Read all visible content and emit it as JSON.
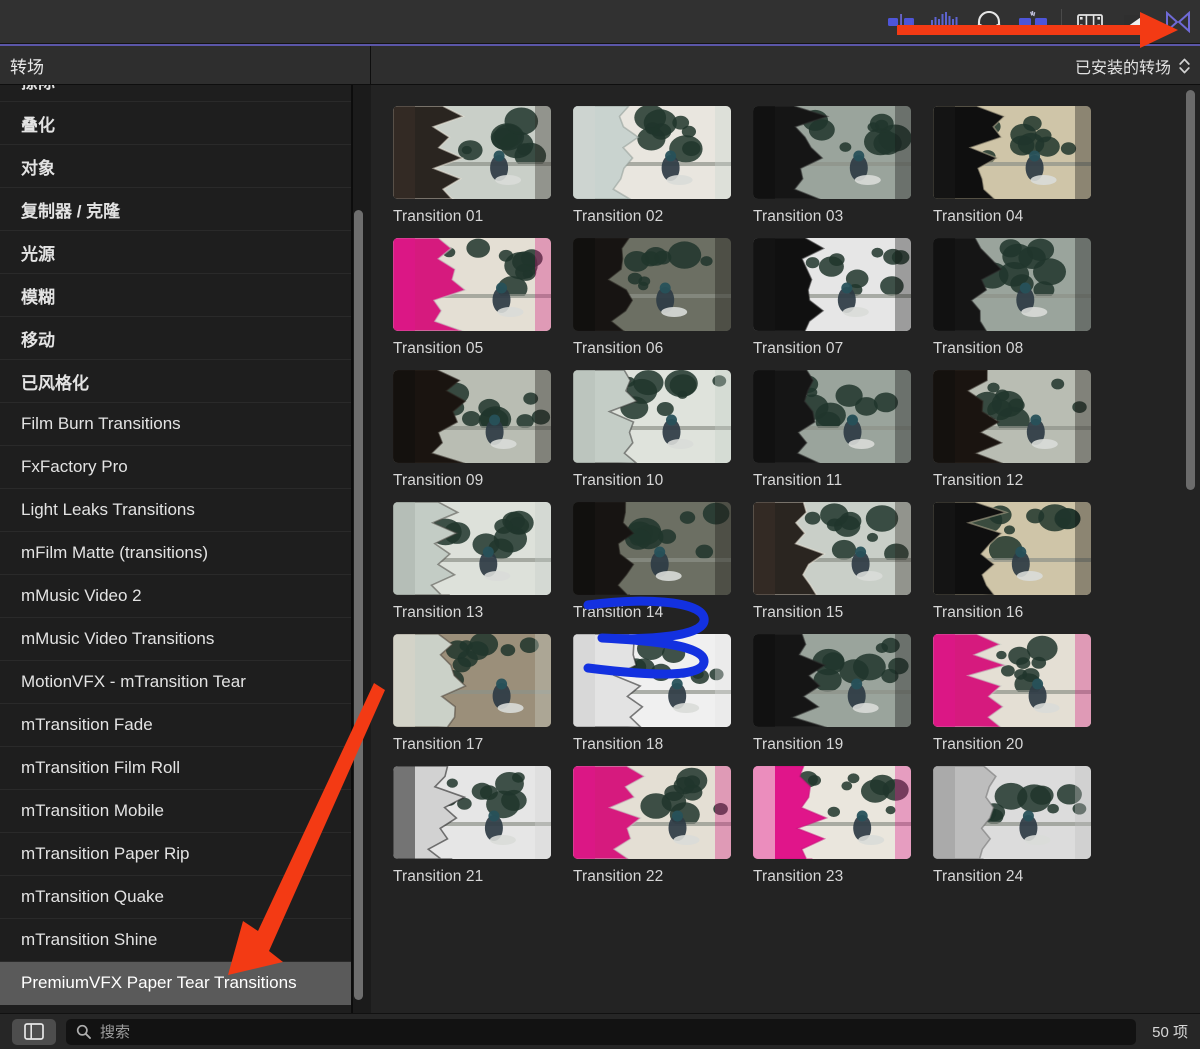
{
  "toolbar": {
    "buttons": [
      {
        "name": "audio-enhance-icon",
        "label": "音频增强"
      },
      {
        "name": "audio-meters-icon",
        "label": "音频指示器"
      },
      {
        "name": "headphones-icon",
        "label": "耳机"
      },
      {
        "name": "color-board-icon",
        "label": "效果"
      },
      {
        "name": "film-strip-icon",
        "label": "媒体"
      },
      {
        "name": "titles-generators-icon",
        "label": "字幕和发生器"
      },
      {
        "name": "transitions-bowtie-icon",
        "label": "转场"
      }
    ],
    "accent_color": "#5b56a8",
    "active_icon_color": "#4e55d8",
    "highlight_color": "#6f6ad6"
  },
  "panel": {
    "title": "转场",
    "popup_label": "已安装的转场"
  },
  "sidebar": {
    "items": [
      {
        "label": "擦际",
        "cjk": true,
        "selected": false
      },
      {
        "label": "叠化",
        "cjk": true,
        "selected": false
      },
      {
        "label": "对象",
        "cjk": true,
        "selected": false
      },
      {
        "label": "复制器 / 克隆",
        "cjk": true,
        "selected": false
      },
      {
        "label": "光源",
        "cjk": true,
        "selected": false
      },
      {
        "label": "模糊",
        "cjk": true,
        "selected": false
      },
      {
        "label": "移动",
        "cjk": true,
        "selected": false
      },
      {
        "label": "已风格化",
        "cjk": true,
        "selected": false
      },
      {
        "label": "Film Burn Transitions",
        "cjk": false,
        "selected": false
      },
      {
        "label": "FxFactory Pro",
        "cjk": false,
        "selected": false
      },
      {
        "label": "Light Leaks Transitions",
        "cjk": false,
        "selected": false
      },
      {
        "label": "mFilm Matte (transitions)",
        "cjk": false,
        "selected": false
      },
      {
        "label": "mMusic Video 2",
        "cjk": false,
        "selected": false
      },
      {
        "label": "mMusic Video Transitions",
        "cjk": false,
        "selected": false
      },
      {
        "label": "MotionVFX - mTransition Tear",
        "cjk": false,
        "selected": false
      },
      {
        "label": "mTransition Fade",
        "cjk": false,
        "selected": false
      },
      {
        "label": "mTransition Film Roll",
        "cjk": false,
        "selected": false
      },
      {
        "label": "mTransition Mobile",
        "cjk": false,
        "selected": false
      },
      {
        "label": "mTransition Paper Rip",
        "cjk": false,
        "selected": false
      },
      {
        "label": "mTransition Quake",
        "cjk": false,
        "selected": false
      },
      {
        "label": "mTransition Shine",
        "cjk": false,
        "selected": false
      },
      {
        "label": "PremiumVFX Paper Tear Transitions",
        "cjk": false,
        "selected": true
      }
    ],
    "selected_background": "#5a5a5a"
  },
  "grid": {
    "items": [
      {
        "label": "Transition 01",
        "style": "tear-right",
        "annotated": false
      },
      {
        "label": "Transition 02",
        "style": "split-portrait",
        "annotated": false
      },
      {
        "label": "Transition 03",
        "style": "dark-rip",
        "annotated": false
      },
      {
        "label": "Transition 04",
        "style": "texture-tear",
        "annotated": false
      },
      {
        "label": "Transition 05",
        "style": "magenta-tear",
        "annotated": false
      },
      {
        "label": "Transition 06",
        "style": "dark-fold",
        "annotated": false
      },
      {
        "label": "Transition 07",
        "style": "karaoke-mono",
        "annotated": false
      },
      {
        "label": "Transition 08",
        "style": "dark-rip",
        "annotated": false
      },
      {
        "label": "Transition 09",
        "style": "night-tear",
        "annotated": false
      },
      {
        "label": "Transition 10",
        "style": "center-fold",
        "annotated": false
      },
      {
        "label": "Transition 11",
        "style": "dark-rip",
        "annotated": false
      },
      {
        "label": "Transition 12",
        "style": "night-tear",
        "annotated": false
      },
      {
        "label": "Transition 13",
        "style": "mirror-tear",
        "annotated": false
      },
      {
        "label": "Transition 14",
        "style": "dark-fold",
        "annotated": true
      },
      {
        "label": "Transition 15",
        "style": "tear-right",
        "annotated": false
      },
      {
        "label": "Transition 16",
        "style": "texture-tear",
        "annotated": false
      },
      {
        "label": "Transition 17",
        "style": "crumple-tear",
        "annotated": false
      },
      {
        "label": "Transition 18",
        "style": "shatter-mono",
        "annotated": false
      },
      {
        "label": "Transition 19",
        "style": "dark-rip",
        "annotated": false
      },
      {
        "label": "Transition 20",
        "style": "magenta-tear",
        "annotated": false
      },
      {
        "label": "Transition 21",
        "style": "mono-dark",
        "annotated": false
      },
      {
        "label": "Transition 22",
        "style": "magenta-tear",
        "annotated": false
      },
      {
        "label": "Transition 23",
        "style": "karaoke-pink",
        "annotated": false
      },
      {
        "label": "Transition 24",
        "style": "mono-street",
        "annotated": false
      }
    ]
  },
  "bottom_bar": {
    "search_placeholder": "搜索",
    "search_value": "",
    "item_count": "50 项"
  },
  "annotations": {
    "arrow_color": "#f33a14",
    "scribble_color": "#1331e0"
  }
}
